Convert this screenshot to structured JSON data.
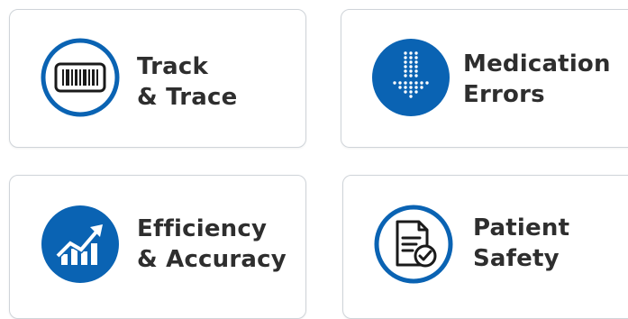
{
  "colors": {
    "brand_blue": "#0a63b3",
    "text": "#2e2e2e",
    "card_border": "#cfd4d9"
  },
  "cards": [
    {
      "icon": "barcode-icon",
      "line1": "Track",
      "line2": "& Trace"
    },
    {
      "icon": "arrow-down-icon",
      "line1": "Medication",
      "line2": "Errors"
    },
    {
      "icon": "growth-chart-icon",
      "line1": "Efficiency",
      "line2": "& Accuracy"
    },
    {
      "icon": "document-check-icon",
      "line1": "Patient",
      "line2": "Safety"
    }
  ]
}
